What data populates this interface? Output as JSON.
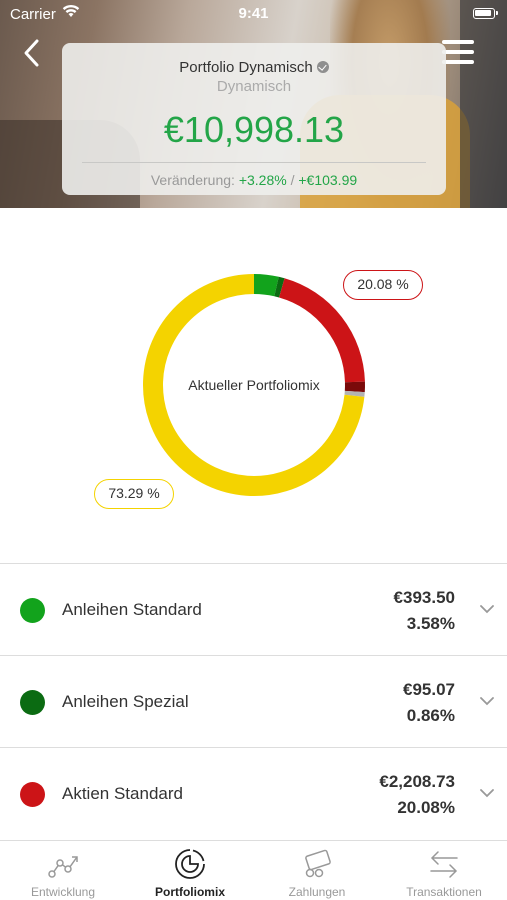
{
  "status": {
    "carrier": "Carrier",
    "time": "9:41"
  },
  "header": {
    "title": "Portfolio Dynamisch",
    "subtitle": "Dynamisch",
    "value": "€10,998.13",
    "change_label": "Veränderung:",
    "change_percent": "+3.28%",
    "change_separator": " / ",
    "change_amount": "+€103.99"
  },
  "chart": {
    "center_label": "Aktueller Portfoliomix",
    "callout_red": "20.08 %",
    "callout_yellow": "73.29 %"
  },
  "chart_data": {
    "type": "pie",
    "categories": [
      "Anleihen Standard",
      "Anleihen Spezial",
      "Aktien Standard",
      "dark-red segment",
      "grey segment",
      "Yellow segment"
    ],
    "values": [
      3.58,
      0.86,
      20.08,
      1.5,
      0.69,
      73.29
    ],
    "colors": [
      "#12a31c",
      "#0b6b12",
      "#cc1417",
      "#7a0a0a",
      "#b3b3b3",
      "#f4d300"
    ],
    "donut": true
  },
  "positions": [
    {
      "name": "Anleihen Standard",
      "amount": "€393.50",
      "percent": "3.58%",
      "color": "#12a31c"
    },
    {
      "name": "Anleihen Spezial",
      "amount": "€95.07",
      "percent": "0.86%",
      "color": "#0b6b12"
    },
    {
      "name": "Aktien Standard",
      "amount": "€2,208.73",
      "percent": "20.08%",
      "color": "#cc1417"
    }
  ],
  "tabs": [
    {
      "label": "Entwicklung",
      "icon": "trend-icon"
    },
    {
      "label": "Portfoliomix",
      "icon": "portfolio-pie-icon"
    },
    {
      "label": "Zahlungen",
      "icon": "payments-icon"
    },
    {
      "label": "Transaktionen",
      "icon": "transactions-icon"
    }
  ],
  "colors": {
    "accent_green": "#23a548",
    "active_tab": "#222222"
  }
}
